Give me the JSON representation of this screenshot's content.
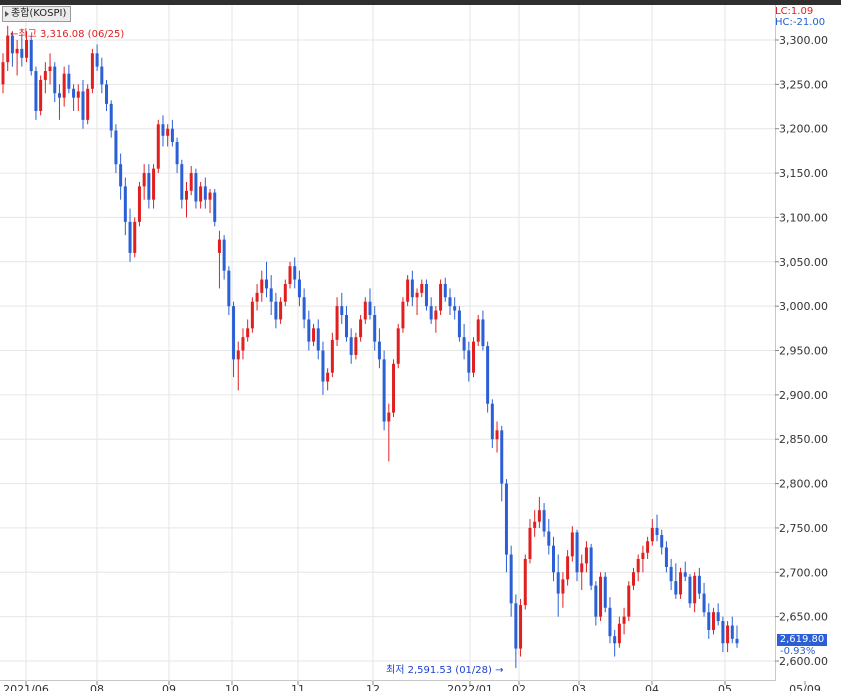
{
  "window": {
    "title": "종합(KOSPI)"
  },
  "chart_data": {
    "type": "candlestick",
    "title": "종합(KOSPI)",
    "high_marker": "최고 3,316.08 (06/25)",
    "low_marker": "최저 2,591.53 (01/28)",
    "lc": "LC:1.09",
    "hc": "HC:-21.00",
    "current_value": "2,619.80",
    "change": "-0.93%",
    "ylim": [
      2600,
      3320
    ],
    "y_ticks": [
      "3,300.00",
      "3,250.00",
      "3,200.00",
      "3,150.00",
      "3,100.00",
      "3,050.00",
      "3,000.00",
      "2,950.00",
      "2,900.00",
      "2,850.00",
      "2,800.00",
      "2,750.00",
      "2,700.00",
      "2,650.00",
      "2,600.00"
    ],
    "x_ticks": [
      "2021/06",
      "08",
      "09",
      "10",
      "11",
      "12",
      "2022/01",
      "02",
      "03",
      "04",
      "05",
      "05/09"
    ],
    "up_color": "#e02020",
    "down_color": "#2b5fd6",
    "candles": [
      [
        3250,
        3285,
        3240,
        3275
      ],
      [
        3275,
        3316,
        3265,
        3305
      ],
      [
        3305,
        3310,
        3270,
        3285
      ],
      [
        3285,
        3300,
        3260,
        3290
      ],
      [
        3290,
        3305,
        3270,
        3280
      ],
      [
        3280,
        3310,
        3275,
        3300
      ],
      [
        3300,
        3305,
        3260,
        3265
      ],
      [
        3265,
        3270,
        3210,
        3220
      ],
      [
        3220,
        3260,
        3215,
        3255
      ],
      [
        3255,
        3275,
        3240,
        3265
      ],
      [
        3265,
        3285,
        3250,
        3270
      ],
      [
        3270,
        3275,
        3230,
        3240
      ],
      [
        3240,
        3250,
        3210,
        3235
      ],
      [
        3235,
        3270,
        3225,
        3262
      ],
      [
        3262,
        3272,
        3240,
        3245
      ],
      [
        3245,
        3250,
        3220,
        3235
      ],
      [
        3235,
        3250,
        3220,
        3242
      ],
      [
        3242,
        3255,
        3200,
        3210
      ],
      [
        3210,
        3250,
        3205,
        3245
      ],
      [
        3245,
        3290,
        3240,
        3285
      ],
      [
        3285,
        3295,
        3265,
        3270
      ],
      [
        3270,
        3280,
        3240,
        3250
      ],
      [
        3250,
        3255,
        3220,
        3228
      ],
      [
        3228,
        3232,
        3190,
        3198
      ],
      [
        3198,
        3205,
        3150,
        3160
      ],
      [
        3160,
        3172,
        3120,
        3135
      ],
      [
        3135,
        3145,
        3080,
        3095
      ],
      [
        3095,
        3110,
        3050,
        3060
      ],
      [
        3060,
        3100,
        3055,
        3095
      ],
      [
        3095,
        3140,
        3090,
        3135
      ],
      [
        3135,
        3160,
        3120,
        3150
      ],
      [
        3150,
        3160,
        3110,
        3120
      ],
      [
        3120,
        3160,
        3110,
        3155
      ],
      [
        3155,
        3210,
        3150,
        3205
      ],
      [
        3205,
        3215,
        3180,
        3192
      ],
      [
        3192,
        3205,
        3180,
        3200
      ],
      [
        3200,
        3210,
        3180,
        3185
      ],
      [
        3185,
        3190,
        3150,
        3160
      ],
      [
        3160,
        3165,
        3110,
        3120
      ],
      [
        3120,
        3140,
        3100,
        3130
      ],
      [
        3130,
        3158,
        3125,
        3150
      ],
      [
        3150,
        3155,
        3110,
        3118
      ],
      [
        3118,
        3140,
        3110,
        3135
      ],
      [
        3135,
        3145,
        3110,
        3120
      ],
      [
        3120,
        3132,
        3105,
        3128
      ],
      [
        3128,
        3132,
        3090,
        3095
      ],
      [
        3060,
        3085,
        3020,
        3075
      ],
      [
        3075,
        3080,
        3030,
        3040
      ],
      [
        3040,
        3045,
        2990,
        3000
      ],
      [
        3000,
        3005,
        2920,
        2940
      ],
      [
        2940,
        2960,
        2905,
        2950
      ],
      [
        2950,
        2975,
        2940,
        2965
      ],
      [
        2965,
        2985,
        2960,
        2975
      ],
      [
        2975,
        3010,
        2970,
        3005
      ],
      [
        3005,
        3025,
        2995,
        3015
      ],
      [
        3015,
        3040,
        3005,
        3030
      ],
      [
        3030,
        3050,
        3010,
        3020
      ],
      [
        3020,
        3035,
        2990,
        3005
      ],
      [
        3005,
        3015,
        2975,
        2985
      ],
      [
        2985,
        3010,
        2980,
        3005
      ],
      [
        3005,
        3030,
        3000,
        3025
      ],
      [
        3025,
        3050,
        3020,
        3045
      ],
      [
        3045,
        3055,
        3020,
        3030
      ],
      [
        3030,
        3040,
        3000,
        3010
      ],
      [
        3010,
        3020,
        2975,
        2985
      ],
      [
        2985,
        2995,
        2950,
        2960
      ],
      [
        2960,
        2980,
        2955,
        2975
      ],
      [
        2975,
        2985,
        2940,
        2950
      ],
      [
        2950,
        2960,
        2900,
        2915
      ],
      [
        2915,
        2930,
        2905,
        2925
      ],
      [
        2925,
        2970,
        2920,
        2962
      ],
      [
        2962,
        3010,
        2955,
        3000
      ],
      [
        3000,
        3015,
        2980,
        2990
      ],
      [
        2990,
        3000,
        2960,
        2965
      ],
      [
        2965,
        2975,
        2935,
        2945
      ],
      [
        2945,
        2970,
        2940,
        2965
      ],
      [
        2965,
        2990,
        2960,
        2985
      ],
      [
        2985,
        3010,
        2980,
        3005
      ],
      [
        3005,
        3020,
        2985,
        2990
      ],
      [
        2990,
        3000,
        2950,
        2960
      ],
      [
        2960,
        2975,
        2930,
        2940
      ],
      [
        2940,
        2950,
        2860,
        2870
      ],
      [
        2870,
        2890,
        2825,
        2880
      ],
      [
        2880,
        2940,
        2875,
        2935
      ],
      [
        2935,
        2980,
        2930,
        2975
      ],
      [
        2975,
        3010,
        2970,
        3005
      ],
      [
        3005,
        3035,
        3000,
        3030
      ],
      [
        3030,
        3040,
        3000,
        3010
      ],
      [
        3010,
        3020,
        2990,
        3015
      ],
      [
        3015,
        3030,
        3010,
        3025
      ],
      [
        3025,
        3030,
        2995,
        3000
      ],
      [
        3000,
        3010,
        2980,
        2985
      ],
      [
        2985,
        3000,
        2970,
        2995
      ],
      [
        2995,
        3030,
        2990,
        3025
      ],
      [
        3025,
        3032,
        3005,
        3010
      ],
      [
        3010,
        3020,
        2990,
        3000
      ],
      [
        3000,
        3010,
        2985,
        2995
      ],
      [
        2995,
        3000,
        2960,
        2965
      ],
      [
        2965,
        2980,
        2940,
        2950
      ],
      [
        2950,
        2960,
        2915,
        2925
      ],
      [
        2925,
        2965,
        2920,
        2960
      ],
      [
        2960,
        2990,
        2955,
        2985
      ],
      [
        2985,
        2995,
        2950,
        2955
      ],
      [
        2955,
        2960,
        2880,
        2890
      ],
      [
        2890,
        2895,
        2840,
        2850
      ],
      [
        2850,
        2870,
        2835,
        2860
      ],
      [
        2860,
        2865,
        2780,
        2800
      ],
      [
        2800,
        2805,
        2700,
        2720
      ],
      [
        2720,
        2730,
        2650,
        2665
      ],
      [
        2665,
        2675,
        2592,
        2614
      ],
      [
        2614,
        2670,
        2605,
        2663
      ],
      [
        2663,
        2720,
        2658,
        2715
      ],
      [
        2715,
        2760,
        2710,
        2750
      ],
      [
        2750,
        2770,
        2740,
        2757
      ],
      [
        2757,
        2785,
        2750,
        2770
      ],
      [
        2770,
        2778,
        2740,
        2746
      ],
      [
        2746,
        2760,
        2720,
        2730
      ],
      [
        2730,
        2740,
        2690,
        2700
      ],
      [
        2700,
        2720,
        2650,
        2676
      ],
      [
        2676,
        2700,
        2660,
        2692
      ],
      [
        2692,
        2725,
        2685,
        2718
      ],
      [
        2718,
        2752,
        2712,
        2745
      ],
      [
        2745,
        2748,
        2690,
        2700
      ],
      [
        2700,
        2720,
        2680,
        2710
      ],
      [
        2710,
        2735,
        2700,
        2728
      ],
      [
        2728,
        2732,
        2680,
        2685
      ],
      [
        2685,
        2690,
        2640,
        2650
      ],
      [
        2650,
        2700,
        2645,
        2695
      ],
      [
        2695,
        2700,
        2655,
        2660
      ],
      [
        2660,
        2672,
        2620,
        2628
      ],
      [
        2628,
        2635,
        2605,
        2620
      ],
      [
        2620,
        2650,
        2615,
        2642
      ],
      [
        2642,
        2660,
        2630,
        2650
      ],
      [
        2650,
        2690,
        2645,
        2685
      ],
      [
        2685,
        2705,
        2680,
        2700
      ],
      [
        2700,
        2720,
        2690,
        2715
      ],
      [
        2715,
        2730,
        2700,
        2722
      ],
      [
        2722,
        2740,
        2715,
        2735
      ],
      [
        2735,
        2760,
        2730,
        2750
      ],
      [
        2750,
        2765,
        2735,
        2742
      ],
      [
        2742,
        2748,
        2720,
        2728
      ],
      [
        2728,
        2735,
        2700,
        2706
      ],
      [
        2706,
        2715,
        2680,
        2690
      ],
      [
        2690,
        2710,
        2670,
        2675
      ],
      [
        2675,
        2705,
        2670,
        2700
      ],
      [
        2700,
        2712,
        2690,
        2695
      ],
      [
        2695,
        2698,
        2660,
        2665
      ],
      [
        2665,
        2700,
        2655,
        2696
      ],
      [
        2696,
        2705,
        2670,
        2676
      ],
      [
        2676,
        2688,
        2650,
        2655
      ],
      [
        2655,
        2665,
        2625,
        2635
      ],
      [
        2635,
        2660,
        2630,
        2655
      ],
      [
        2655,
        2665,
        2640,
        2645
      ],
      [
        2645,
        2650,
        2610,
        2620
      ],
      [
        2620,
        2645,
        2610,
        2640
      ],
      [
        2640,
        2650,
        2620,
        2625
      ],
      [
        2625,
        2640,
        2615,
        2620
      ]
    ]
  }
}
